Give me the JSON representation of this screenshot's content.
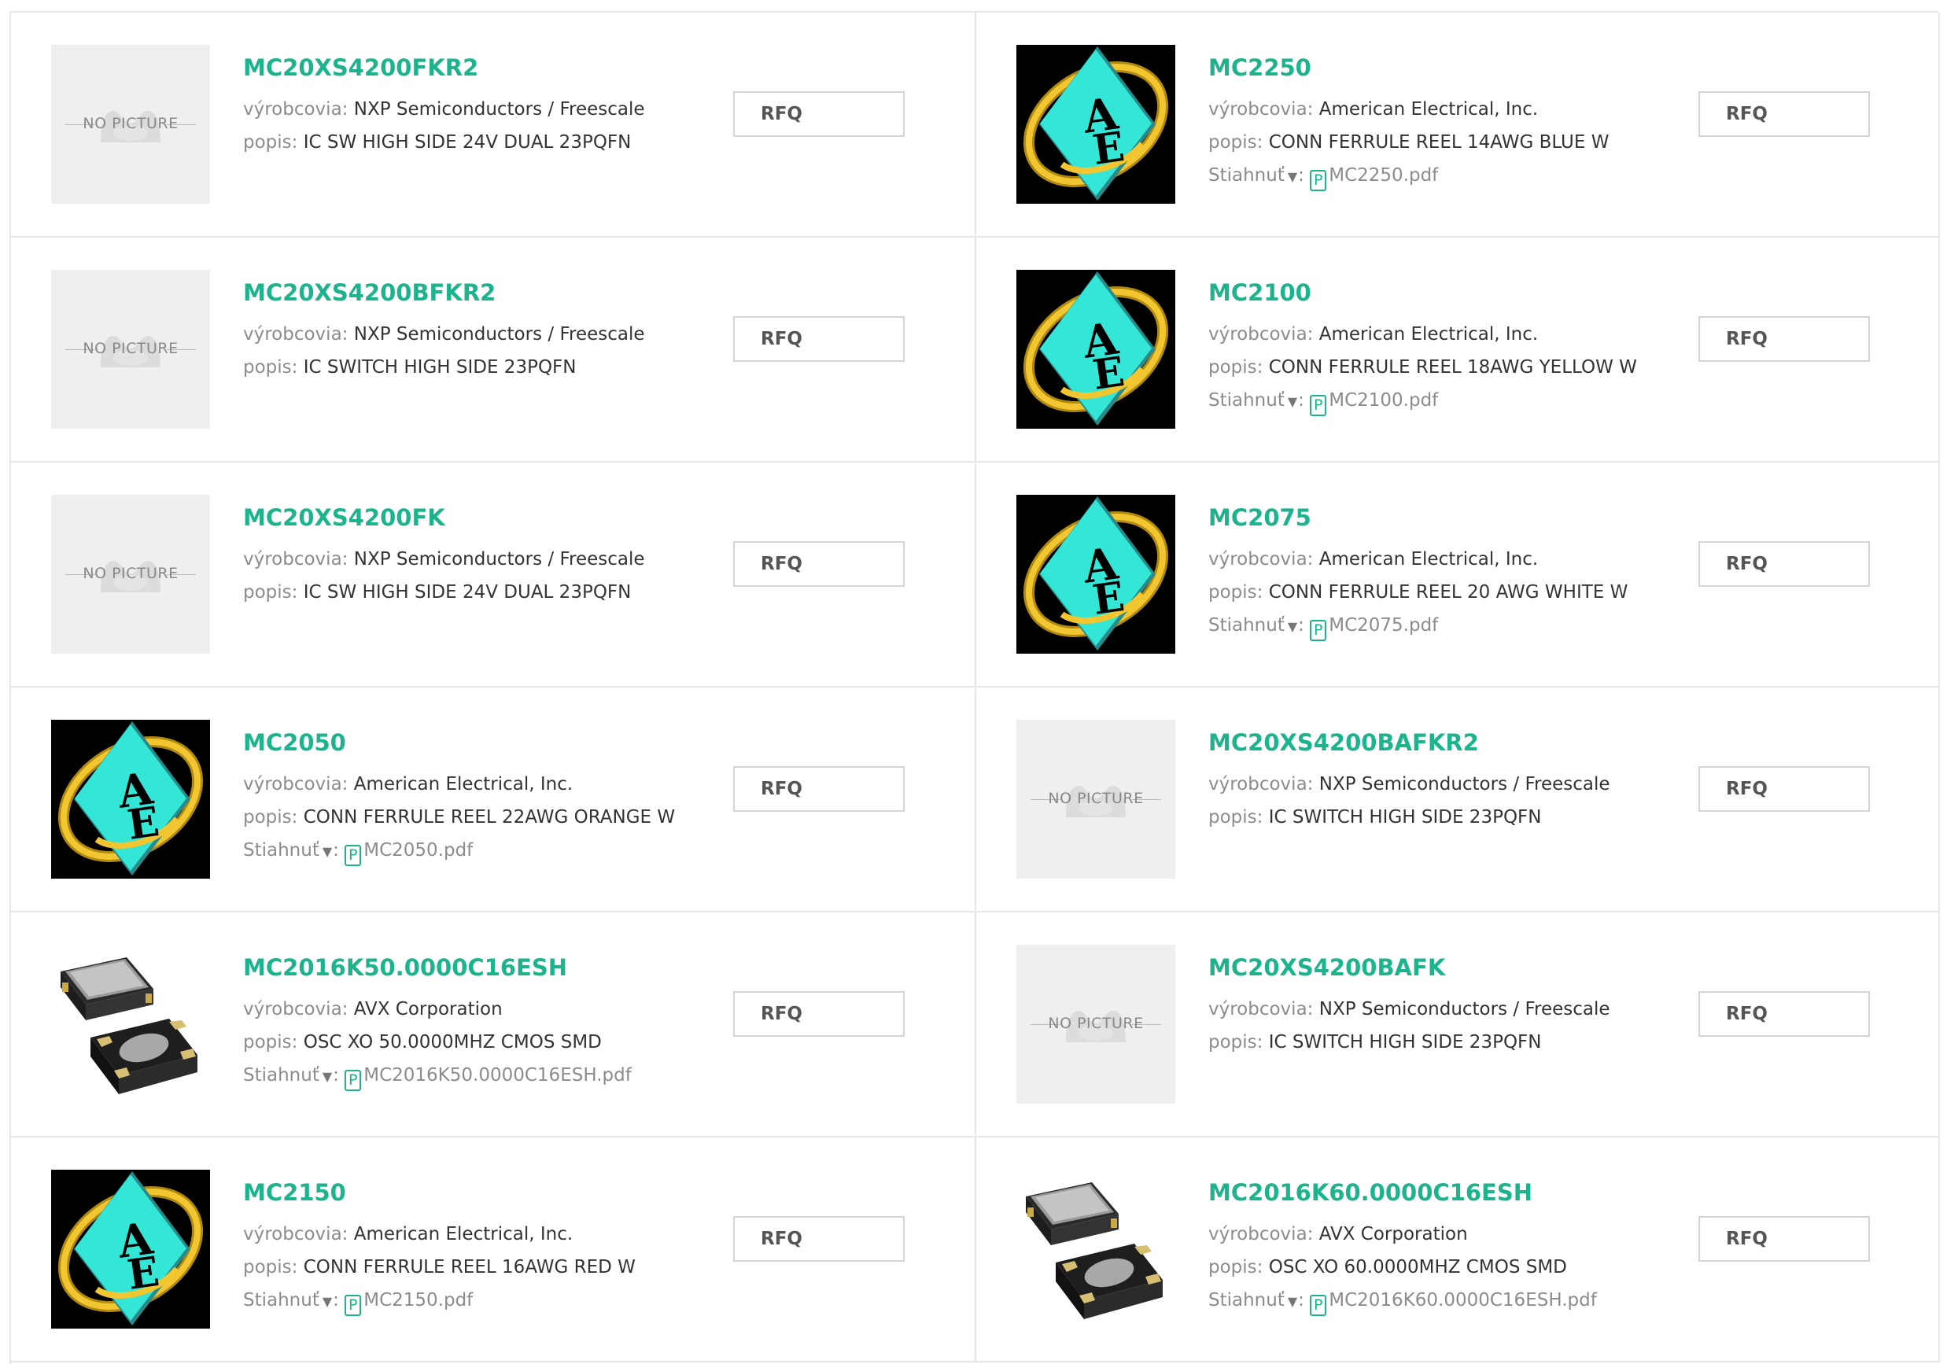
{
  "labels": {
    "manufacturer": "výrobcovia:",
    "description": "popis:",
    "download": "Stiahnuť",
    "download_arrow": "▼",
    "download_colon": ":",
    "rfq": "RFQ",
    "no_picture": "NO PICTURE",
    "pdf_icon": "P"
  },
  "colors": {
    "accent": "#1db38c",
    "label_gray": "#8c8c8c",
    "border": "#e6e6e6"
  },
  "products": [
    {
      "part": "MC20XS4200FKR2",
      "manufacturer": "NXP Semiconductors / Freescale",
      "description": "IC SW HIGH SIDE 24V DUAL 23PQFN",
      "pdf": "",
      "image": "no-picture"
    },
    {
      "part": "MC2250",
      "manufacturer": "American Electrical, Inc.",
      "description": "CONN FERRULE REEL 14AWG BLUE W",
      "pdf": "MC2250.pdf",
      "image": "ae-logo"
    },
    {
      "part": "MC20XS4200BFKR2",
      "manufacturer": "NXP Semiconductors / Freescale",
      "description": "IC SWITCH HIGH SIDE 23PQFN",
      "pdf": "",
      "image": "no-picture"
    },
    {
      "part": "MC2100",
      "manufacturer": "American Electrical, Inc.",
      "description": "CONN FERRULE REEL 18AWG YELLOW W",
      "pdf": "MC2100.pdf",
      "image": "ae-logo"
    },
    {
      "part": "MC20XS4200FK",
      "manufacturer": "NXP Semiconductors / Freescale",
      "description": "IC SW HIGH SIDE 24V DUAL 23PQFN",
      "pdf": "",
      "image": "no-picture"
    },
    {
      "part": "MC2075",
      "manufacturer": "American Electrical, Inc.",
      "description": "CONN FERRULE REEL 20 AWG WHITE W",
      "pdf": "MC2075.pdf",
      "image": "ae-logo"
    },
    {
      "part": "MC2050",
      "manufacturer": "American Electrical, Inc.",
      "description": "CONN FERRULE REEL 22AWG ORANGE W",
      "pdf": "MC2050.pdf",
      "image": "ae-logo"
    },
    {
      "part": "MC20XS4200BAFKR2",
      "manufacturer": "NXP Semiconductors / Freescale",
      "description": "IC SWITCH HIGH SIDE 23PQFN",
      "pdf": "",
      "image": "no-picture"
    },
    {
      "part": "MC2016K50.0000C16ESH",
      "manufacturer": "AVX Corporation",
      "description": "OSC XO 50.0000MHZ CMOS SMD",
      "pdf": "MC2016K50.0000C16ESH.pdf",
      "image": "oscillator"
    },
    {
      "part": "MC20XS4200BAFK",
      "manufacturer": "NXP Semiconductors / Freescale",
      "description": "IC SWITCH HIGH SIDE 23PQFN",
      "pdf": "",
      "image": "no-picture"
    },
    {
      "part": "MC2150",
      "manufacturer": "American Electrical, Inc.",
      "description": "CONN FERRULE REEL 16AWG RED W",
      "pdf": "MC2150.pdf",
      "image": "ae-logo"
    },
    {
      "part": "MC2016K60.0000C16ESH",
      "manufacturer": "AVX Corporation",
      "description": "OSC XO 60.0000MHZ CMOS SMD",
      "pdf": "MC2016K60.0000C16ESH.pdf",
      "image": "oscillator"
    }
  ]
}
